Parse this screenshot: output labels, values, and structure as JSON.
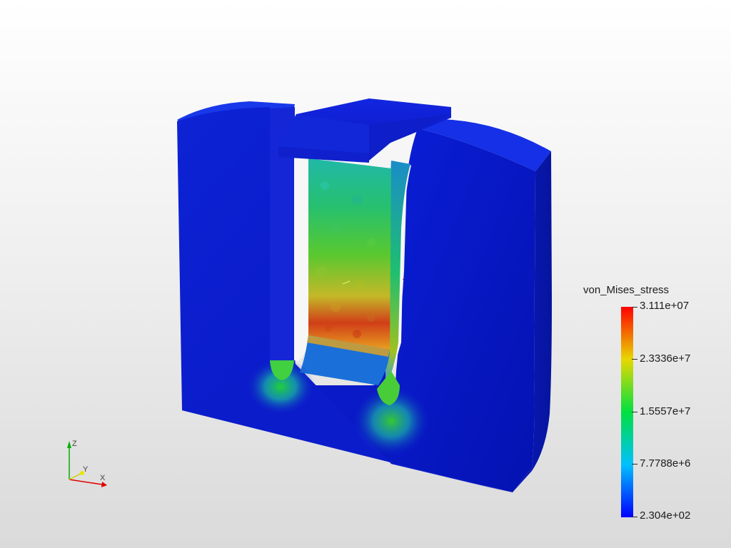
{
  "viewer": {
    "scalar_field": "von_Mises_stress",
    "scalar_bar": {
      "title": "von_Mises_stress",
      "max_label": "3.111e+07",
      "tick_labels": [
        "3.111e+07",
        "2.3336e+7",
        "1.5557e+7",
        "7.7788e+6",
        "2.304e+02"
      ],
      "min_label": "2.304e+02",
      "colormap": [
        "#0000ff",
        "#00bfff",
        "#00ff40",
        "#ffd700",
        "#ff0000"
      ]
    },
    "orientation_axes": {
      "x_label": "X",
      "y_label": "Y",
      "z_label": "Z",
      "x_color": "#e00000",
      "y_color": "#e8e800",
      "z_color": "#00c000"
    },
    "model": {
      "color_low": "#0a1ad8",
      "color_high": "#e02010",
      "description_icon": "fem-model-icon"
    }
  }
}
